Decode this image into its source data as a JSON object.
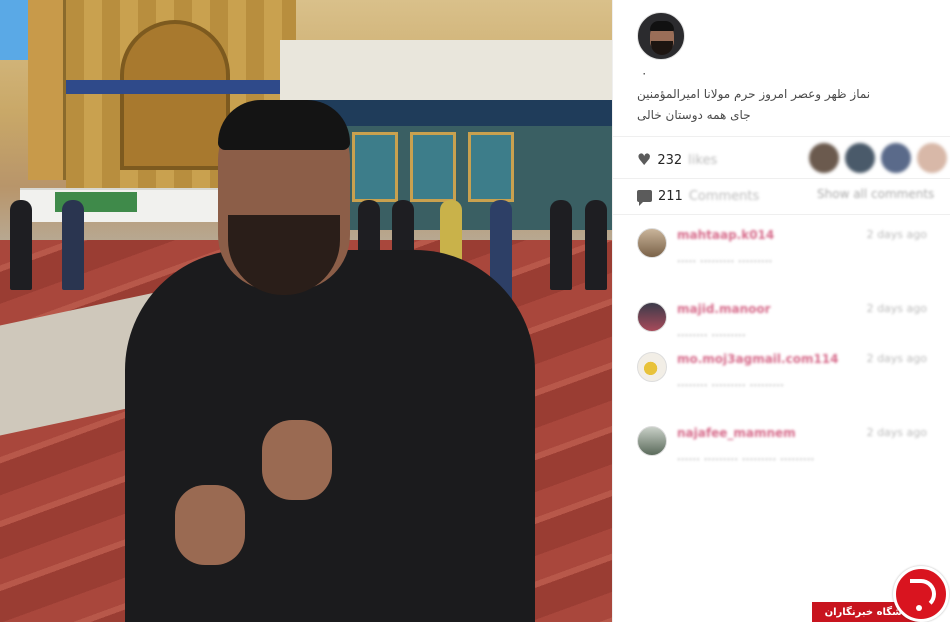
{
  "post": {
    "photo": {
      "scene": "shrine-courtyard-portrait"
    },
    "author_avatar_icon": "user-avatar-icon",
    "dot": "۰",
    "caption_lines": [
      "نماز ظهر وعصر امروز حرم مولانا امیرالمؤمنین",
      "جای همه دوستان خالی"
    ],
    "likes": {
      "icon": "heart-icon",
      "count": "232",
      "word": "likes"
    },
    "comments_summary": {
      "icon": "comment-bubble-icon",
      "count": "211",
      "word": "Comments",
      "show_all_label": "Show all comments"
    },
    "comments": [
      {
        "user": "mahtaap.k014",
        "time": "2 days ago",
        "text": "......... ......... ....."
      },
      {
        "user": "majid.manoor",
        "time": "2 days ago",
        "text": "......... ........"
      },
      {
        "user": "mo.moj3agmail.com114",
        "time": "2 days ago",
        "text": "......... ......... ........"
      },
      {
        "user": "najafee_mamnem",
        "time": "2 days ago",
        "text": "......... ......... ......... ......"
      }
    ]
  },
  "watermark": {
    "label": "باشگاه خبرنگاران",
    "logo_icon": "yjc-logo-icon",
    "color": "#d9141f"
  }
}
